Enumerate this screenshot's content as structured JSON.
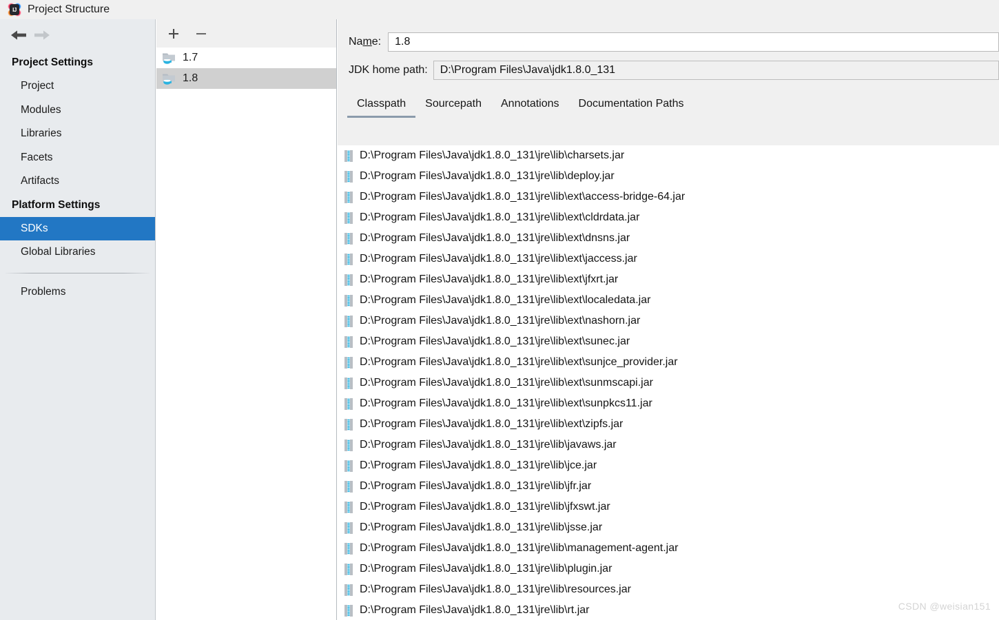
{
  "window": {
    "title": "Project Structure",
    "app_icon": "intellij-idea-icon"
  },
  "navigation": {
    "back_icon": "arrow-left-icon",
    "forward_icon": "arrow-right-icon"
  },
  "sidebar": {
    "groups": [
      {
        "title": "Project Settings",
        "items": [
          {
            "label": "Project",
            "selected": false
          },
          {
            "label": "Modules",
            "selected": false
          },
          {
            "label": "Libraries",
            "selected": false
          },
          {
            "label": "Facets",
            "selected": false
          },
          {
            "label": "Artifacts",
            "selected": false
          }
        ]
      },
      {
        "title": "Platform Settings",
        "items": [
          {
            "label": "SDKs",
            "selected": true
          },
          {
            "label": "Global Libraries",
            "selected": false
          }
        ]
      }
    ],
    "footer_items": [
      {
        "label": "Problems",
        "selected": false
      }
    ]
  },
  "sdk_panel": {
    "toolbar": {
      "add_label": "+",
      "add_icon": "plus-icon",
      "remove_label": "−",
      "remove_icon": "minus-icon"
    },
    "items": [
      {
        "label": "1.7",
        "selected": false,
        "icon": "jdk-folder-icon"
      },
      {
        "label": "1.8",
        "selected": true,
        "icon": "jdk-folder-icon"
      }
    ]
  },
  "details": {
    "name_label_pre": "Na",
    "name_label_mnemonic": "m",
    "name_label_post": "e:",
    "name_value": "1.8",
    "jdk_home_label": "JDK home path:",
    "jdk_home_value": "D:\\Program Files\\Java\\jdk1.8.0_131",
    "tabs": [
      {
        "label": "Classpath",
        "active": true
      },
      {
        "label": "Sourcepath",
        "active": false
      },
      {
        "label": "Annotations",
        "active": false
      },
      {
        "label": "Documentation Paths",
        "active": false
      }
    ],
    "classpath_entries": [
      "D:\\Program Files\\Java\\jdk1.8.0_131\\jre\\lib\\charsets.jar",
      "D:\\Program Files\\Java\\jdk1.8.0_131\\jre\\lib\\deploy.jar",
      "D:\\Program Files\\Java\\jdk1.8.0_131\\jre\\lib\\ext\\access-bridge-64.jar",
      "D:\\Program Files\\Java\\jdk1.8.0_131\\jre\\lib\\ext\\cldrdata.jar",
      "D:\\Program Files\\Java\\jdk1.8.0_131\\jre\\lib\\ext\\dnsns.jar",
      "D:\\Program Files\\Java\\jdk1.8.0_131\\jre\\lib\\ext\\jaccess.jar",
      "D:\\Program Files\\Java\\jdk1.8.0_131\\jre\\lib\\ext\\jfxrt.jar",
      "D:\\Program Files\\Java\\jdk1.8.0_131\\jre\\lib\\ext\\localedata.jar",
      "D:\\Program Files\\Java\\jdk1.8.0_131\\jre\\lib\\ext\\nashorn.jar",
      "D:\\Program Files\\Java\\jdk1.8.0_131\\jre\\lib\\ext\\sunec.jar",
      "D:\\Program Files\\Java\\jdk1.8.0_131\\jre\\lib\\ext\\sunjce_provider.jar",
      "D:\\Program Files\\Java\\jdk1.8.0_131\\jre\\lib\\ext\\sunmscapi.jar",
      "D:\\Program Files\\Java\\jdk1.8.0_131\\jre\\lib\\ext\\sunpkcs11.jar",
      "D:\\Program Files\\Java\\jdk1.8.0_131\\jre\\lib\\ext\\zipfs.jar",
      "D:\\Program Files\\Java\\jdk1.8.0_131\\jre\\lib\\javaws.jar",
      "D:\\Program Files\\Java\\jdk1.8.0_131\\jre\\lib\\jce.jar",
      "D:\\Program Files\\Java\\jdk1.8.0_131\\jre\\lib\\jfr.jar",
      "D:\\Program Files\\Java\\jdk1.8.0_131\\jre\\lib\\jfxswt.jar",
      "D:\\Program Files\\Java\\jdk1.8.0_131\\jre\\lib\\jsse.jar",
      "D:\\Program Files\\Java\\jdk1.8.0_131\\jre\\lib\\management-agent.jar",
      "D:\\Program Files\\Java\\jdk1.8.0_131\\jre\\lib\\plugin.jar",
      "D:\\Program Files\\Java\\jdk1.8.0_131\\jre\\lib\\resources.jar",
      "D:\\Program Files\\Java\\jdk1.8.0_131\\jre\\lib\\rt.jar"
    ]
  },
  "watermark": "CSDN @weisian151",
  "colors": {
    "selection_blue": "#2277c4",
    "sidebar_bg": "#e8ebee",
    "panel_bg": "#f0f0f0",
    "list_selection_gray": "#d0d0d0",
    "tab_underline": "#8b9bac",
    "jar_icon_blue": "#2bb3e0"
  }
}
